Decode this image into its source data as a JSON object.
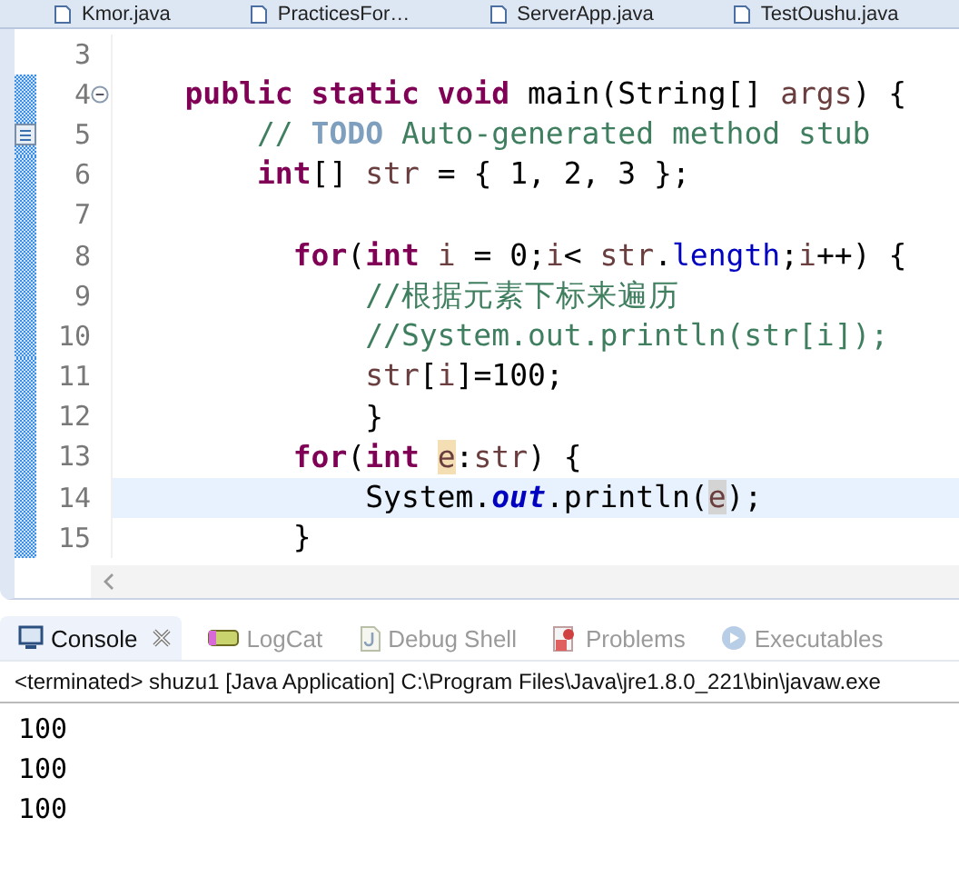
{
  "editor_tabs": [
    {
      "label": "Kmor.java",
      "selected": false
    },
    {
      "label": "PracticesFor…",
      "selected": false
    },
    {
      "label": "ServerApp.java",
      "selected": false
    },
    {
      "label": "TestOushu.java",
      "selected": false
    }
  ],
  "editor": {
    "lines": [
      {
        "number": "3",
        "changed": false
      },
      {
        "number": "4",
        "changed": true,
        "folded": false,
        "tokens": [
          {
            "kind": "keyword",
            "text": "    public static void"
          },
          {
            "kind": "plain",
            "text": " main(String[] "
          },
          {
            "kind": "local",
            "text": "args"
          },
          {
            "kind": "plain",
            "text": ") {"
          }
        ]
      },
      {
        "number": "5",
        "changed": true,
        "task_marker": true,
        "tokens": [
          {
            "kind": "comment",
            "text": "        // "
          },
          {
            "kind": "todo",
            "text": "TODO"
          },
          {
            "kind": "comment",
            "text": " Auto-generated method stub"
          }
        ]
      },
      {
        "number": "6",
        "changed": true,
        "tokens": [
          {
            "kind": "keyword",
            "text": "        int"
          },
          {
            "kind": "plain",
            "text": "[] "
          },
          {
            "kind": "local",
            "text": "str"
          },
          {
            "kind": "plain",
            "text": " = { 1, 2, 3 };"
          }
        ]
      },
      {
        "number": "7",
        "changed": true
      },
      {
        "number": "8",
        "changed": true,
        "tokens": [
          {
            "kind": "keyword",
            "text": "          for"
          },
          {
            "kind": "plain",
            "text": "("
          },
          {
            "kind": "keyword",
            "text": "int"
          },
          {
            "kind": "local",
            "text": " i"
          },
          {
            "kind": "plain",
            "text": " = 0;"
          },
          {
            "kind": "local",
            "text": "i"
          },
          {
            "kind": "plain",
            "text": "< "
          },
          {
            "kind": "local",
            "text": "str"
          },
          {
            "kind": "plain",
            "text": "."
          },
          {
            "kind": "field",
            "text": "length"
          },
          {
            "kind": "plain",
            "text": ";"
          },
          {
            "kind": "local",
            "text": "i"
          },
          {
            "kind": "plain",
            "text": "++) {"
          }
        ]
      },
      {
        "number": "9",
        "changed": true,
        "tokens": [
          {
            "kind": "comment",
            "text": "              //根据元素下标来遍历"
          }
        ]
      },
      {
        "number": "10",
        "changed": true,
        "tokens": [
          {
            "kind": "comment",
            "text": "              //System.out.println(str[i]);"
          }
        ]
      },
      {
        "number": "11",
        "changed": true,
        "tokens": [
          {
            "kind": "local",
            "text": "              str"
          },
          {
            "kind": "plain",
            "text": "["
          },
          {
            "kind": "local",
            "text": "i"
          },
          {
            "kind": "plain",
            "text": "]=100;"
          }
        ]
      },
      {
        "number": "12",
        "changed": true,
        "tokens": [
          {
            "kind": "plain",
            "text": "              }"
          }
        ]
      },
      {
        "number": "13",
        "changed": true,
        "tokens": [
          {
            "kind": "keyword",
            "text": "          for"
          },
          {
            "kind": "plain",
            "text": "("
          },
          {
            "kind": "keyword",
            "text": "int "
          },
          {
            "kind": "occurrence",
            "text": "e"
          },
          {
            "kind": "plain",
            "text": ":"
          },
          {
            "kind": "local",
            "text": "str"
          },
          {
            "kind": "plain",
            "text": ") {"
          }
        ]
      },
      {
        "number": "14",
        "changed": true,
        "current": true,
        "tokens": [
          {
            "kind": "plain",
            "text": "              System."
          },
          {
            "kind": "static",
            "text": "out"
          },
          {
            "kind": "plain",
            "text": ".println("
          },
          {
            "kind": "read",
            "text": "e"
          },
          {
            "kind": "plain",
            "text": ");"
          }
        ]
      },
      {
        "number": "15",
        "changed": true,
        "tokens": [
          {
            "kind": "plain",
            "text": "          }"
          }
        ]
      }
    ]
  },
  "console": {
    "tabs": [
      {
        "label": "Console",
        "kind": "console",
        "selected": true,
        "closable": true
      },
      {
        "label": "LogCat",
        "kind": "logcat",
        "selected": false
      },
      {
        "label": "Debug Shell",
        "kind": "shell",
        "selected": false
      },
      {
        "label": "Problems",
        "kind": "problems",
        "selected": false
      },
      {
        "label": "Executables",
        "kind": "executables",
        "selected": false
      }
    ],
    "status": "<terminated> shuzu1 [Java Application] C:\\Program Files\\Java\\jre1.8.0_221\\bin\\javaw.exe",
    "output": [
      "100",
      "100",
      "100"
    ]
  }
}
